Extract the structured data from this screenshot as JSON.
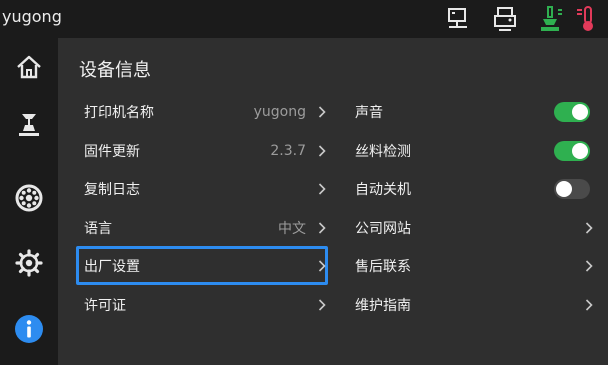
{
  "app": {
    "name": "yugong"
  },
  "page": {
    "title": "设备信息"
  },
  "left_items": [
    {
      "label": "打印机名称",
      "value": "yugong"
    },
    {
      "label": "固件更新",
      "value": "2.3.7"
    },
    {
      "label": "复制日志",
      "value": ""
    },
    {
      "label": "语言",
      "value": "中文"
    },
    {
      "label": "出厂设置",
      "value": ""
    },
    {
      "label": "许可证",
      "value": ""
    }
  ],
  "right_items": [
    {
      "label": "声音",
      "toggle": "on"
    },
    {
      "label": "丝料检测",
      "toggle": "on"
    },
    {
      "label": "自动关机",
      "toggle": "off"
    },
    {
      "label": "公司网站"
    },
    {
      "label": "售后联系"
    },
    {
      "label": "维护指南"
    }
  ],
  "colors": {
    "accent": "#2d8cf0",
    "toggle_on": "#2fb050",
    "temp_nozzle": "#2fb050",
    "temp_bed": "#e23a5a",
    "info_active": "#2d8cf0"
  },
  "icons": {
    "top": [
      "network-icon",
      "printer-icon",
      "nozzle-temperature-icon",
      "bed-temperature-icon"
    ],
    "nav": [
      "home-icon",
      "print-icon",
      "filament-icon",
      "settings-icon",
      "info-icon"
    ]
  }
}
